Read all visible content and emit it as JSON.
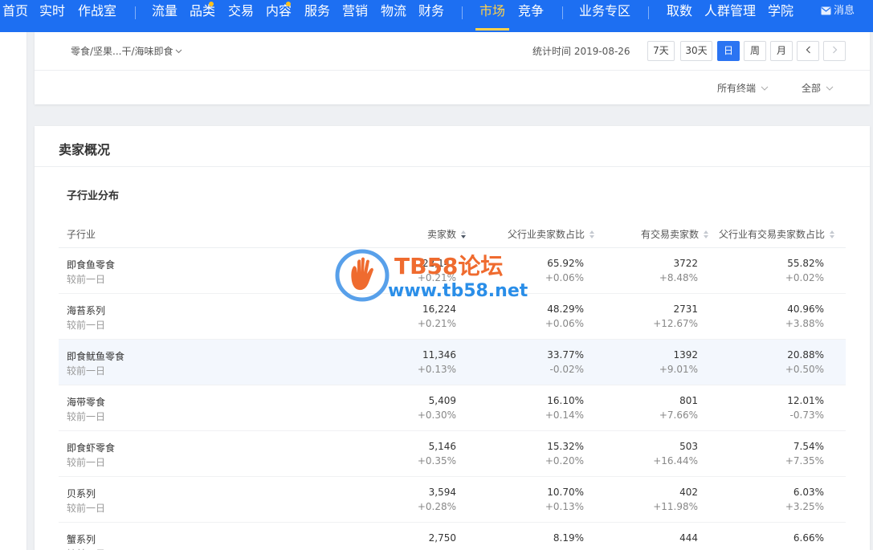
{
  "nav": {
    "items": [
      {
        "label": "首页"
      },
      {
        "label": "实时"
      },
      {
        "label": "作战室"
      },
      {
        "label": "流量"
      },
      {
        "label": "品类"
      },
      {
        "label": "交易"
      },
      {
        "label": "内容"
      },
      {
        "label": "服务"
      },
      {
        "label": "营销"
      },
      {
        "label": "物流"
      },
      {
        "label": "财务"
      },
      {
        "label": "市场"
      },
      {
        "label": "竞争"
      },
      {
        "label": "业务专区"
      },
      {
        "label": "取数"
      },
      {
        "label": "人群管理"
      },
      {
        "label": "学院"
      }
    ],
    "active": "市场",
    "message": "消息",
    "accent": "#1d6ff2",
    "active_color": "#ffd24a"
  },
  "filter": {
    "breadcrumb": "零食/坚果...干/海味即食",
    "stat_time": "统计时间 2019-08-26",
    "range_buttons": [
      {
        "label": "7天"
      },
      {
        "label": "30天"
      },
      {
        "label": "日"
      },
      {
        "label": "周"
      },
      {
        "label": "月"
      }
    ],
    "active_range": "日",
    "prev_icon": "chevron-left-icon",
    "next_icon": "chevron-right-icon",
    "terminal_select": "所有终端",
    "scope_select": "全部"
  },
  "section": {
    "title": "卖家概况",
    "subtitle": "子行业分布"
  },
  "table": {
    "columns": [
      "子行业",
      "卖家数",
      "父行业卖家数占比",
      "有交易卖家数",
      "父行业有交易卖家数占比"
    ],
    "compare_label": "较前一日",
    "rows": [
      {
        "name": "即食鱼零食",
        "sellers": "22,147",
        "sellers_chg": "+0.21%",
        "share": "65.92%",
        "share_chg": "+0.06%",
        "trade": "3722",
        "trade_chg": "+8.48%",
        "trade_share": "55.82%",
        "trade_share_chg": "+0.02%"
      },
      {
        "name": "海苔系列",
        "sellers": "16,224",
        "sellers_chg": "+0.21%",
        "share": "48.29%",
        "share_chg": "+0.06%",
        "trade": "2731",
        "trade_chg": "+12.67%",
        "trade_share": "40.96%",
        "trade_share_chg": "+3.88%"
      },
      {
        "name": "即食鱿鱼零食",
        "sellers": "11,346",
        "sellers_chg": "+0.13%",
        "share": "33.77%",
        "share_chg": "-0.02%",
        "trade": "1392",
        "trade_chg": "+9.01%",
        "trade_share": "20.88%",
        "trade_share_chg": "+0.50%"
      },
      {
        "name": "海带零食",
        "sellers": "5,409",
        "sellers_chg": "+0.30%",
        "share": "16.10%",
        "share_chg": "+0.14%",
        "trade": "801",
        "trade_chg": "+7.66%",
        "trade_share": "12.01%",
        "trade_share_chg": "-0.73%"
      },
      {
        "name": "即食虾零食",
        "sellers": "5,146",
        "sellers_chg": "+0.35%",
        "share": "15.32%",
        "share_chg": "+0.20%",
        "trade": "503",
        "trade_chg": "+16.44%",
        "trade_share": "7.54%",
        "trade_share_chg": "+7.35%"
      },
      {
        "name": "贝系列",
        "sellers": "3,594",
        "sellers_chg": "+0.28%",
        "share": "10.70%",
        "share_chg": "+0.13%",
        "trade": "402",
        "trade_chg": "+11.98%",
        "trade_share": "6.03%",
        "trade_share_chg": "+3.25%"
      },
      {
        "name": "蟹系列",
        "sellers": "2,750",
        "sellers_chg": "",
        "share": "8.19%",
        "share_chg": "",
        "trade": "444",
        "trade_chg": "",
        "trade_share": "6.66%",
        "trade_share_chg": ""
      }
    ]
  },
  "watermark": {
    "title": "TB58论坛",
    "url": "www.tb58.net"
  }
}
